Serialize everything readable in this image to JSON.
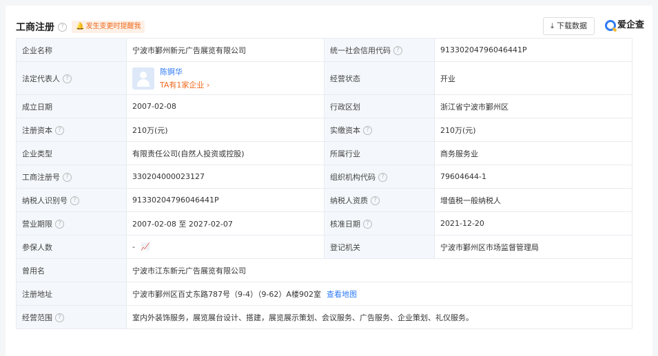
{
  "header": {
    "title": "工商注册",
    "help": "?",
    "notify": "发生变更时提醒我",
    "download": "下载数据",
    "brand": "爱企查"
  },
  "rows": [
    {
      "l1": "企业名称",
      "v1": "宁波市鄞州新元广告展览有限公司",
      "l2": "统一社会信用代码",
      "v2": "91330204796046441P"
    },
    {
      "l1": "法定代表人",
      "rep_name": "陈锕华",
      "rep_count": "TA有1家企业 ›",
      "l2": "经营状态",
      "v2": "开业"
    },
    {
      "l1": "成立日期",
      "v1": "2007-02-08",
      "l2": "行政区划",
      "v2": "浙江省宁波市鄞州区"
    },
    {
      "l1": "注册资本",
      "v1": "210万(元)",
      "l2": "实缴资本",
      "v2": "210万(元)"
    },
    {
      "l1": "企业类型",
      "v1": "有限责任公司(自然人投资或控股)",
      "l2": "所属行业",
      "v2": "商务服务业"
    },
    {
      "l1": "工商注册号",
      "v1": "330204000023127",
      "l2": "组织机构代码",
      "v2": "79604644-1"
    },
    {
      "l1": "纳税人识别号",
      "v1": "91330204796046441P",
      "l2": "纳税人资质",
      "v2": "增值税一般纳税人"
    },
    {
      "l1": "营业期限",
      "v1": "2007-02-08 至 2027-02-07",
      "l2": "核准日期",
      "v2": "2021-12-20"
    },
    {
      "l1": "参保人数",
      "v1": "-",
      "l2": "登记机关",
      "v2": "宁波市鄞州区市场监督管理局"
    },
    {
      "l1": "曾用名",
      "v1": "宁波市江东新元广告展览有限公司"
    },
    {
      "l1": "注册地址",
      "v1": "宁波市鄞州区百丈东路787号（9-4）（9-62）A楼902室",
      "link": "查看地图"
    },
    {
      "l1": "经营范围",
      "v1": "室内外装饰服务，展览展台设计、搭建，展览展示策划、会议服务、广告服务、企业策划、礼仪服务。"
    }
  ]
}
